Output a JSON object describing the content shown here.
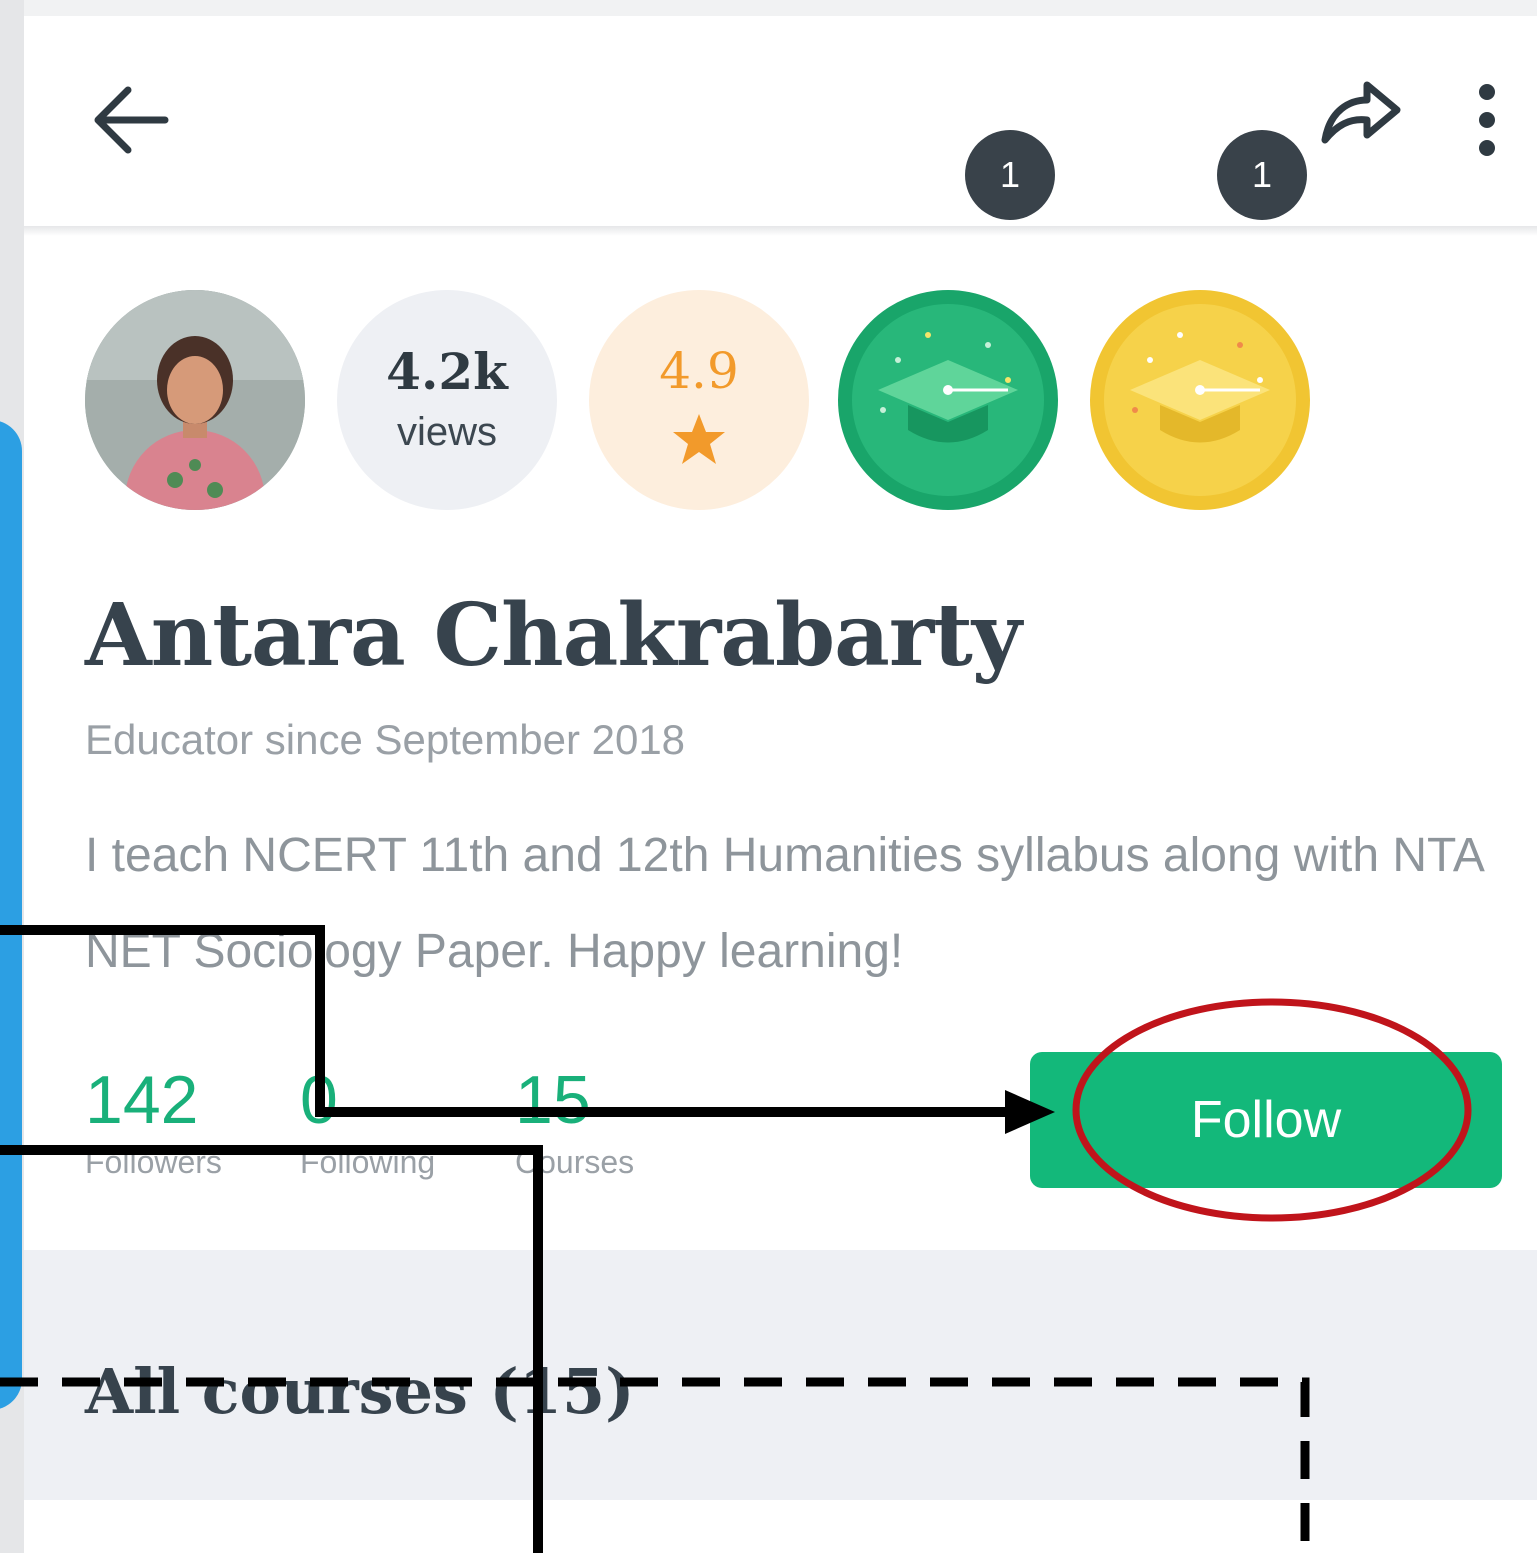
{
  "header": {
    "back_icon": "arrow-left-icon",
    "share_icon": "share-icon",
    "more_icon": "more-vertical-icon"
  },
  "badges": {
    "views": {
      "value": "4.2k",
      "label": "views"
    },
    "rating": {
      "value": "4.9",
      "icon": "star-icon"
    },
    "green_badge": {
      "icon": "graduation-cap-icon",
      "count": "1"
    },
    "gold_badge": {
      "icon": "graduation-cap-icon",
      "count": "1"
    }
  },
  "profile": {
    "name": "Antara Chakrabarty",
    "since": "Educator since September 2018",
    "bio": "I teach NCERT 11th and 12th Humanities syllabus along with NTA NET Sociology Paper. Happy learning!"
  },
  "stats": [
    {
      "value": "142",
      "label": "Followers"
    },
    {
      "value": "0",
      "label": "Following"
    },
    {
      "value": "15",
      "label": "Courses"
    }
  ],
  "follow": {
    "label": "Follow"
  },
  "section": {
    "title": "All courses (15)"
  },
  "colors": {
    "accent": "#13b87a",
    "rating": "#f29a2b",
    "annotation_circle": "#c0141b",
    "annotation_lines": "#000000",
    "side_tab": "#2c9fe3"
  }
}
